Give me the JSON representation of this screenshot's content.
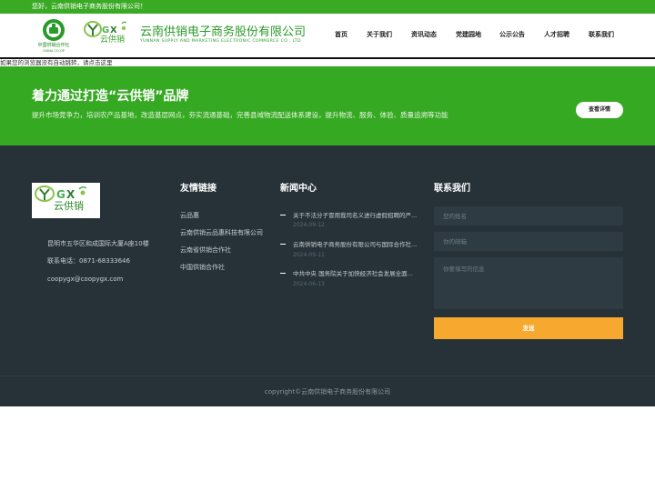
{
  "topbar": {
    "greeting": "您好，云南供销电子商务股份有限公司！"
  },
  "header": {
    "coop_logo_cn": "中国供销合作社",
    "coop_logo_en": "CHINA CO-OP",
    "brand_mark": "云供销",
    "company_cn": "云南供销电子商务股份有限公司",
    "company_en": "YUNNAN SUPPLY AND MARKETING ELECTRONIC COMMERCE CO., LTD",
    "nav": [
      "首页",
      "关于我们",
      "资讯动态",
      "党建园地",
      "公示公告",
      "人才招聘",
      "联系我们"
    ]
  },
  "redirect_notice": "如果您的浏览器没有自动跳转，请点击这里",
  "banner": {
    "title": "着力通过打造“云供销”品牌",
    "subtitle": "提升市场竞争力，培训农产品基地，改造基层网点，夯实流通基础，完善县域物流配送体系建设，提升物流、服务、体验、质量追溯等功能",
    "button": "查看详情"
  },
  "footer": {
    "logo_brand": "云供销",
    "address": "昆明市五华区和成国际大厦A座10楼",
    "phone": "联系电话：0871-68333646",
    "email": "coopygx@coopygx.com",
    "links_heading": "友情链接",
    "links": [
      "云品惠",
      "云南供销云品惠科技有限公司",
      "云南省供销合作社",
      "中国供销合作社"
    ],
    "news_heading": "新闻中心",
    "news": [
      {
        "title": "关于不法分子冒用我司名义进行虚假招聘的严...",
        "date": "2024-09-12"
      },
      {
        "title": "云南供销电子商务股份有限公司与国际合作社...",
        "date": "2024-09-11"
      },
      {
        "title": "中共中央 国务院关于加快经济社会发展全面...",
        "date": "2024-06-13"
      }
    ],
    "contact_heading": "联系我们",
    "form": {
      "name_placeholder": "您的姓名",
      "email_placeholder": "你的邮箱",
      "message_placeholder": "你要填写的信息",
      "submit": "发送"
    },
    "copyright": "copyright©云南供销电子商务股份有限公司"
  },
  "colors": {
    "brand_green": "#36a923",
    "footer_bg": "#263238",
    "submit_orange": "#f6a92e"
  }
}
